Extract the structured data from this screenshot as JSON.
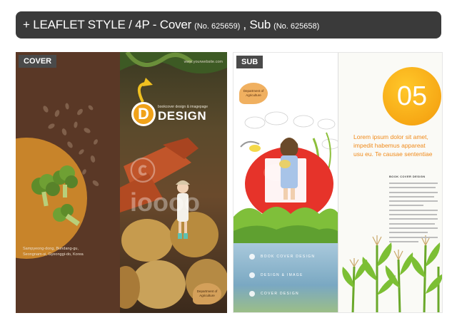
{
  "header": {
    "prefix": "+ LEAFLET STYLE / 4P - Cover",
    "cover_no": "(No. 625659)",
    "separator": ", Sub",
    "sub_no": "(No. 625658)"
  },
  "cover": {
    "tag": "COVER",
    "address_line1": "Sampyeong-dong, Bundang-gu,",
    "address_line2": "Seongnam-si, Gyeonggi-do, Korea",
    "website": "www.yourwebsite.com",
    "design_letter": "D",
    "design_sub": "bookcover design & imagepage",
    "design_word": "DESIGN",
    "dept_line1": "Department of",
    "dept_line2": "Agriculture",
    "watermark": "ⓒ ioooo"
  },
  "sub": {
    "tag": "SUB",
    "dept_line1": "Department of",
    "dept_line2": "Agriculture",
    "big_number": "05",
    "lorem_line1": "Lorem ipsum dolor sit amet,",
    "lorem_line2": "impedit habemus appareat",
    "lorem_line3": "usu eu. Te causae sententiae",
    "book_title": "BOOK COVER DESIGN",
    "menu": [
      {
        "label": "BOOK COVER DESIGN"
      },
      {
        "label": "DESIGN & IMAGE"
      },
      {
        "label": "COVER DESIGN"
      }
    ]
  },
  "colors": {
    "header_bg": "#3a3a3a",
    "cover_brown": "#5a3826",
    "accent_orange": "#f39a0c",
    "lorem_orange": "#f08a1a"
  }
}
